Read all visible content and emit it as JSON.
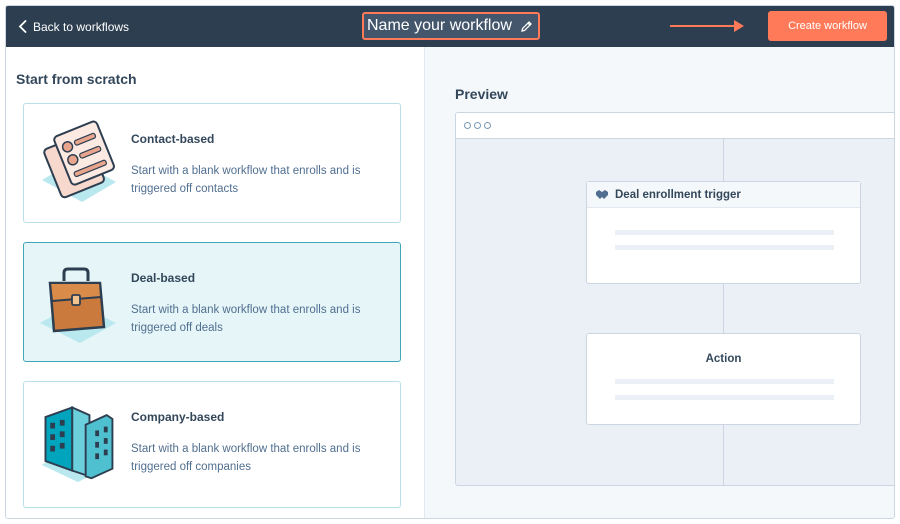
{
  "topbar": {
    "back_label": "Back to workflows",
    "workflow_name": "Name your workflow",
    "create_button_label": "Create workflow"
  },
  "left_panel": {
    "section_title": "Start from scratch",
    "cards": [
      {
        "title": "Contact-based",
        "description": "Start with a blank workflow that enrolls and is triggered off contacts",
        "icon": "contact-cards-illustration",
        "selected": false
      },
      {
        "title": "Deal-based",
        "description": "Start with a blank workflow that enrolls and is triggered off deals",
        "icon": "briefcase-illustration",
        "selected": true
      },
      {
        "title": "Company-based",
        "description": "Start with a blank workflow that enrolls and is triggered off companies",
        "icon": "building-illustration",
        "selected": false
      }
    ]
  },
  "preview": {
    "title": "Preview",
    "trigger_node_label": "Deal enrollment trigger",
    "action_node_label": "Action"
  },
  "colors": {
    "topbar": "#2d3e50",
    "accent": "#ff7a59",
    "selected_card_bg": "#e5f5f8",
    "selected_card_border": "#3ea7b8"
  }
}
